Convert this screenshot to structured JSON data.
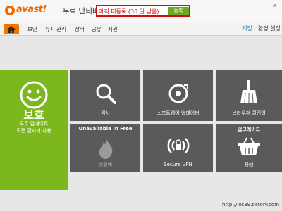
{
  "titlebar": {
    "brand": "avast!",
    "app_title": "무료 안티바이러스",
    "registration_status": "아직 미등록 (30 일 남음)",
    "register_button": "등록",
    "close_glyph": "✕"
  },
  "nav": {
    "items": [
      "보안",
      "유지 관리",
      "장터",
      "공유",
      "지원"
    ],
    "account": "계정",
    "settings": "환경 설정"
  },
  "tiles": {
    "status": {
      "title": "보호",
      "line1": "모두 업데이트",
      "line2": "모든 감시기 사용"
    },
    "scan": {
      "label": "검사"
    },
    "software_updater": {
      "label": "소프트웨어 업데이터"
    },
    "browser_cleanup": {
      "label": "브라우저 클린업"
    },
    "firewall": {
      "badge": "Unavailable in Free",
      "label": "방화벽"
    },
    "secure_vpn": {
      "label": "Secure VPN"
    },
    "store": {
      "badge": "업그레이드",
      "label": "장터"
    }
  },
  "watermark": "http://jos39.tistory.com",
  "colors": {
    "brand_orange": "#f06a00",
    "status_green": "#7cb71e",
    "tile_gray": "#5a5a5a",
    "alert_red": "#cc1111"
  }
}
